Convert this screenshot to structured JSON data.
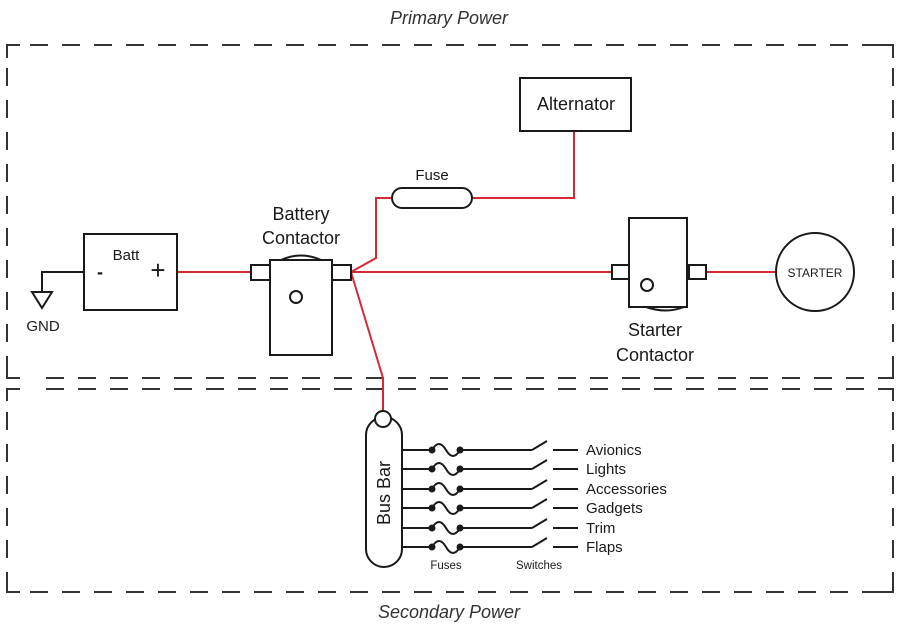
{
  "regions": {
    "primary": {
      "label": "Primary Power"
    },
    "secondary": {
      "label": "Secondary Power"
    }
  },
  "components": {
    "battery": {
      "label": "Batt",
      "negative": "-",
      "positive": "+"
    },
    "ground": {
      "label": "GND"
    },
    "battery_contactor": {
      "line1": "Battery",
      "line2": "Contactor"
    },
    "fuse": {
      "label": "Fuse"
    },
    "alternator": {
      "label": "Alternator"
    },
    "starter_contactor": {
      "line1": "Starter",
      "line2": "Contactor"
    },
    "starter": {
      "label": "STARTER"
    },
    "bus_bar": {
      "label": "Bus Bar"
    }
  },
  "circuits": {
    "fuses_label": "Fuses",
    "switches_label": "Switches",
    "loads": [
      {
        "label": "Avionics"
      },
      {
        "label": "Lights"
      },
      {
        "label": "Accessories"
      },
      {
        "label": "Gadgets"
      },
      {
        "label": "Trim"
      },
      {
        "label": "Flaps"
      }
    ]
  },
  "colors": {
    "power_wire": "#d32a35",
    "ink": "#1a1a1a"
  }
}
